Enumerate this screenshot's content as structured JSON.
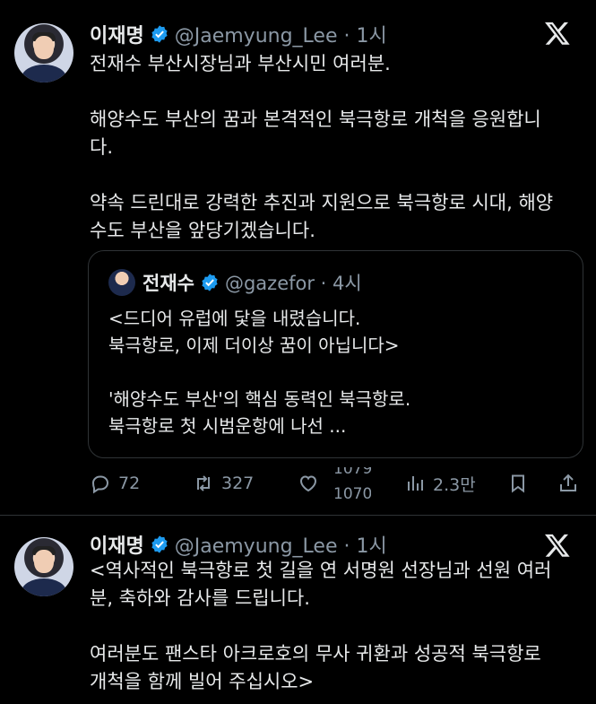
{
  "tweets": [
    {
      "name": "이재명",
      "handle": "@Jaemyung_Lee · 1시",
      "text": "전재수 부산시장님과 부산시민 여러분.\n\n해양수도 부산의 꿈과 본격적인 북극항로 개척을 응원합니\n다.\n\n약속 드린대로 강력한 추진과 지원으로 북극항로 시대, 해양\n수도 부산을 앞당기겠습니다.",
      "quote": {
        "name": "전재수",
        "handle": "@gazefor · 4시",
        "text": "<드디어 유럽에 닻을 내렸습니다.\n북극항로, 이제 더이상 꿈이 아닙니다>\n\n'해양수도 부산'의 핵심 동력인 북극항로.\n북극항로 첫 시범운항에 나선 ..."
      },
      "actions": {
        "replies": "72",
        "reposts": "327",
        "likes_top": "1079",
        "likes_bottom": "1070",
        "views": "2.3만"
      }
    },
    {
      "name": "이재명",
      "handle": "@Jaemyung_Lee · 1시",
      "text": "<역사적인 북극항로 첫 길을 연 서명원 선장님과 선원 여러\n분, 축하와 감사를 드립니다.\n\n여러분도 팬스타 아크로호의 무사 귀환과 성공적 북극항로\n개척을 함께 빌어 주십시오>"
    }
  ],
  "colors": {
    "background": "#000000",
    "text": "#e7e9ea",
    "secondary": "#8b98a5",
    "verified": "#1d9bf0",
    "border": "#2f3336"
  },
  "icons": [
    "verified-icon",
    "x-logo-icon",
    "reply-icon",
    "repost-icon",
    "like-icon",
    "views-icon",
    "bookmark-icon",
    "share-icon"
  ]
}
